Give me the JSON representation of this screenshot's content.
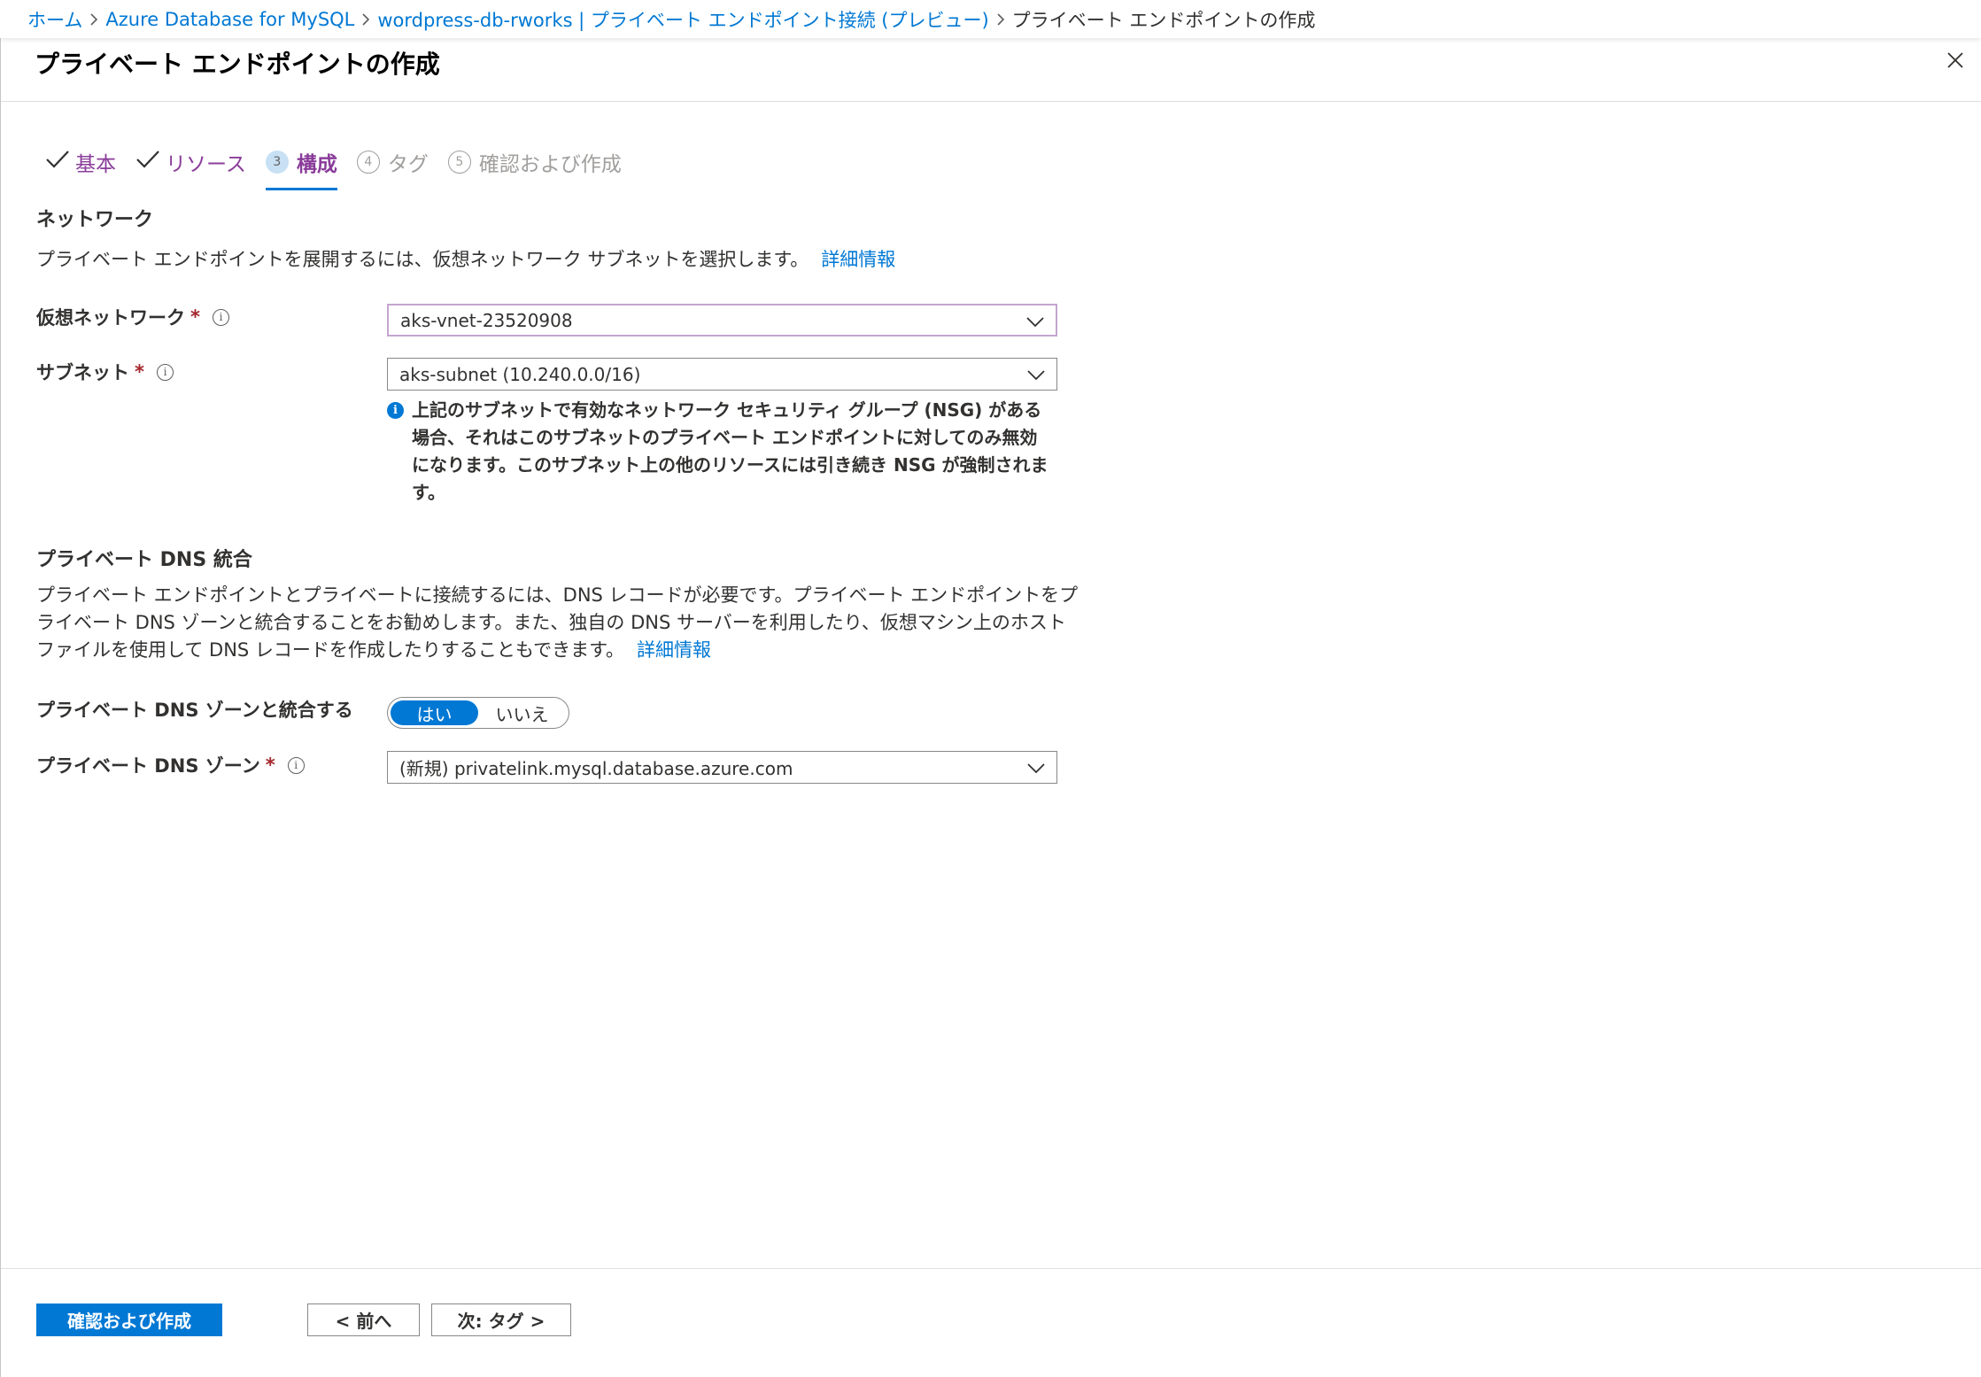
{
  "breadcrumb": {
    "items": [
      "ホーム",
      "Azure Database for MySQL",
      "wordpress-db-rworks | プライベート エンドポイント接続 (プレビュー)"
    ],
    "current": "プライベート エンドポイントの作成"
  },
  "blade": {
    "title": "プライベート エンドポイントの作成",
    "close_icon": "close-icon"
  },
  "tabs": [
    {
      "label": "基本",
      "state": "done"
    },
    {
      "label": "リソース",
      "state": "done"
    },
    {
      "number": "3",
      "label": "構成",
      "state": "active"
    },
    {
      "number": "4",
      "label": "タグ",
      "state": "pending"
    },
    {
      "number": "5",
      "label": "確認および作成",
      "state": "pending"
    }
  ],
  "network": {
    "title": "ネットワーク",
    "description": "プライベート エンドポイントを展開するには、仮想ネットワーク サブネットを選択します。",
    "learn_more": "詳細情報",
    "vnet_label": "仮想ネットワーク",
    "vnet_value": "aks-vnet-23520908",
    "subnet_label": "サブネット",
    "subnet_value": "aks-subnet (10.240.0.0/16)",
    "notice_lines": [
      "上記のサブネットで有効なネットワーク セキュリティ グループ (NSG) がある",
      "場合、それはこのサブネットのプライベート エンドポイントに対してのみ無効",
      "になります。このサブネット上の他のリソースには引き続き NSG が強制されま",
      "す。"
    ]
  },
  "dns": {
    "title": "プライベート DNS 統合",
    "description_lines": [
      "プライベート エンドポイントとプライベートに接続するには、DNS レコードが必要です。プライベート エンドポイントをプ",
      "ライベート DNS ゾーンと統合することをお勧めします。また、独自の DNS サーバーを利用したり、仮想マシン上のホスト",
      "ファイルを使用して DNS レコードを作成したりすることもできます。"
    ],
    "learn_more": "詳細情報",
    "integrate_label": "プライベート DNS ゾーンと統合する",
    "toggle_yes": "はい",
    "toggle_no": "いいえ",
    "toggle_selected": "はい",
    "zone_label": "プライベート DNS ゾーン",
    "zone_value": "(新規) privatelink.mysql.database.azure.com"
  },
  "footer": {
    "review_create": "確認および作成",
    "previous": "< 前へ",
    "next": "次: タグ >"
  },
  "required_mark": "*",
  "info_glyph": "i",
  "colors": {
    "accent": "#0078d4",
    "tab_text": "#8a3d9a",
    "required": "#a4262c"
  }
}
